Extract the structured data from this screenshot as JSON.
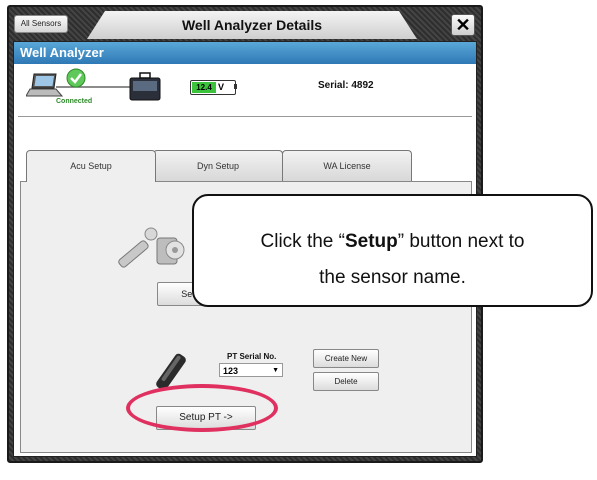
{
  "titlebar": {
    "all_sensors_label": "All Sensors",
    "title": "Well Analyzer Details",
    "close_label": "✕"
  },
  "header": {
    "title": "Well Analyzer"
  },
  "status": {
    "connection": "Connected",
    "battery_value": "12.4",
    "battery_unit": "V",
    "serial": "Serial: 4892"
  },
  "tabs": [
    {
      "label": "Acu Setup",
      "active": true
    },
    {
      "label": "Dyn Setup",
      "active": false
    },
    {
      "label": "WA License",
      "active": false
    }
  ],
  "acu": {
    "setup_label": "Setup"
  },
  "pt": {
    "serial_label": "PT Serial No.",
    "serial_value": "123",
    "create_label": "Create New",
    "delete_label": "Delete",
    "setup_label": "Setup PT ->"
  },
  "callout": {
    "prefix": "Click the “",
    "bold": "Setup",
    "suffix": "” button next to",
    "line2": "the sensor name."
  },
  "colors": {
    "header_blue": "#3d8cc7",
    "connected_green": "#2f8a2a",
    "highlight_ring": "#e03060",
    "battery_green": "#3bc43b"
  },
  "icons": [
    "laptop-icon",
    "check-icon",
    "device-case-icon",
    "battery-icon",
    "gauge-sensor-icon",
    "pressure-transducer-icon",
    "close-icon",
    "dropdown-arrow-icon"
  ]
}
